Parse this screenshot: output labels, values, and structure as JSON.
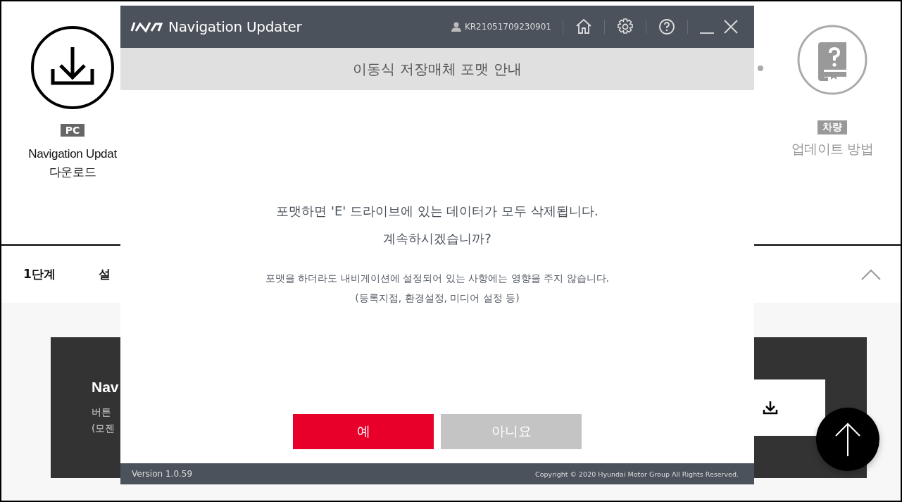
{
  "background": {
    "left_item": {
      "badge": "PC",
      "title_lines": [
        "Navigation Updat",
        "다운로드"
      ]
    },
    "right_item": {
      "badge": "차량",
      "title": "업데이트 방법"
    },
    "steps": [
      "1단계",
      "설"
    ],
    "card": {
      "title": "Nav",
      "lines": [
        "버튼",
        "(모젠"
      ]
    }
  },
  "dialog": {
    "app_title": "Navigation Updater",
    "user_id": "KR21051709230901",
    "heading": "이동식 저장매체 포맷 안내",
    "message_lines": [
      "포맷하면 'E' 드라이브에 있는 데이터가 모두 삭제됩니다.",
      "계속하시겠습니까?"
    ],
    "note_lines": [
      "포맷을 하더라도 내비게이션에 설정되어 있는 사항에는 영향을 주지 않습니다.",
      "(등록지점, 환경설정, 미디어 설정 등)"
    ],
    "buttons": [
      {
        "label": "예",
        "kind": "primary"
      },
      {
        "label": "아니요",
        "kind": "secondary"
      }
    ],
    "version": "Version 1.0.59",
    "copyright": "Copyright © 2020 Hyundai Motor Group All Rights Reserved."
  }
}
